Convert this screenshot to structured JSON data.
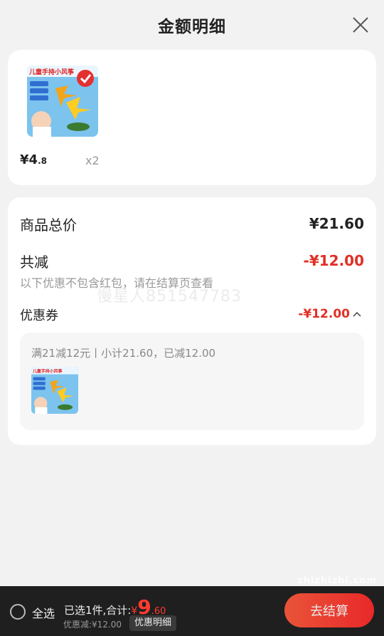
{
  "header": {
    "title": "金额明细",
    "close_icon": "close-icon"
  },
  "product": {
    "banner_text": "儿童手持小风筝",
    "price_int": "¥4",
    "price_dec": ".8",
    "qty": "x2"
  },
  "summary": {
    "total_label": "商品总价",
    "total_value": "¥21.60",
    "reduce_label": "共减",
    "reduce_value": "-¥12.00",
    "note": "以下优惠不包含红包，请在结算页查看",
    "watermark": "慢星人851547783"
  },
  "coupon": {
    "label": "优惠券",
    "value": "-¥12.00",
    "chevron_icon": "chevron-up-icon",
    "desc": "满21减12元丨小计21.60，已减12.00"
  },
  "bottom": {
    "select_all": "全选",
    "selected_prefix": "已选1件,合计:",
    "total_symbol": "¥",
    "total_int": "9",
    "total_dec": ".60",
    "discount": "优惠减:¥12.00",
    "detail_btn": "优惠明细",
    "checkout_btn": "去结算"
  },
  "site_watermark": "zhizhizhi.com",
  "colors": {
    "accent_red": "#e03026",
    "bar_bg": "#1f1f1f"
  }
}
